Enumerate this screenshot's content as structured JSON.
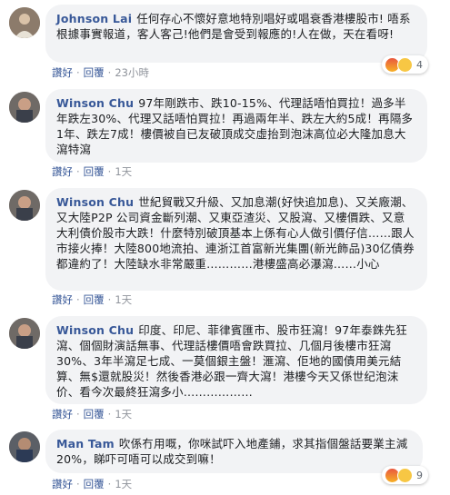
{
  "comments": [
    {
      "author": "Johnson Lai",
      "text": "任何存心不懷好意地特別唱好或唱衰香港樓股市! 唔系根據事實報道，客人客己!他們是會受到報應的!人在做，天在看呀!",
      "actions": {
        "like": "讚好",
        "reply": "回覆",
        "time": "23小時"
      },
      "reactions": {
        "count": "4",
        "icons": [
          "angry-reaction-icon",
          "haha-reaction-icon"
        ]
      }
    },
    {
      "author": "Winson Chu",
      "text": "97年剛跌市、跌10-15%、代理話唔怕買拉！過多半年跌左30%、代理又話唔怕買拉！再過兩年半、跌左大約5成！再隔多1年、跌左7成！樓價被自已友破頂成交虛抬到泡沫高位必大隆加息大瀉特瀉",
      "actions": {
        "like": "讚好",
        "reply": "回覆",
        "time": "1天"
      }
    },
    {
      "author": "Winson Chu",
      "text": "世紀貿戰又升級、又加息潮(好快追加息)、又关廠潮、又大陸P2P 公司資金斷列潮、又東亞渣災、又股瀉、又樓價跌、又意大利債价股市大跌！什麼特別破頂基本上係有心人做引價仔信……跟人市接火捧！大陸800地流拍、連浙江首富新光集團(新光飾品)30亿債券都違約了！大陸缺水非常嚴重…………港樓盛高必瀑瀉……小心",
      "actions": {
        "like": "讚好",
        "reply": "回覆",
        "time": "1天"
      }
    },
    {
      "author": "Winson Chu",
      "text": "印度、印尼、菲律賓匯市、股市狂瀉！97年泰銖先狂瀉、個個財演話無事、代理話樓價唔會跌買拉、几個月後樓市狂瀉30%、3年半瀉足七成、一莫個銀主盤！滙瀉、佢地的國債用美元結算、無$還就股災！然後香港必跟一齊大瀉！港樓今天又係世纪泡沫价、看今次最終狂瀉多小………………",
      "actions": {
        "like": "讚好",
        "reply": "回覆",
        "time": "1天"
      }
    },
    {
      "author": "Man Tam",
      "text": "吹係冇用嘅，你咪試吓入地產鋪，求其指個盤話要業主減20%，睇吓可唔可以成交到嘛！",
      "actions": {
        "like": "讚好",
        "reply": "回覆",
        "time": "1天"
      },
      "reactions": {
        "count": "9",
        "icons": [
          "angry-reaction-icon",
          "haha-reaction-icon"
        ]
      }
    }
  ]
}
